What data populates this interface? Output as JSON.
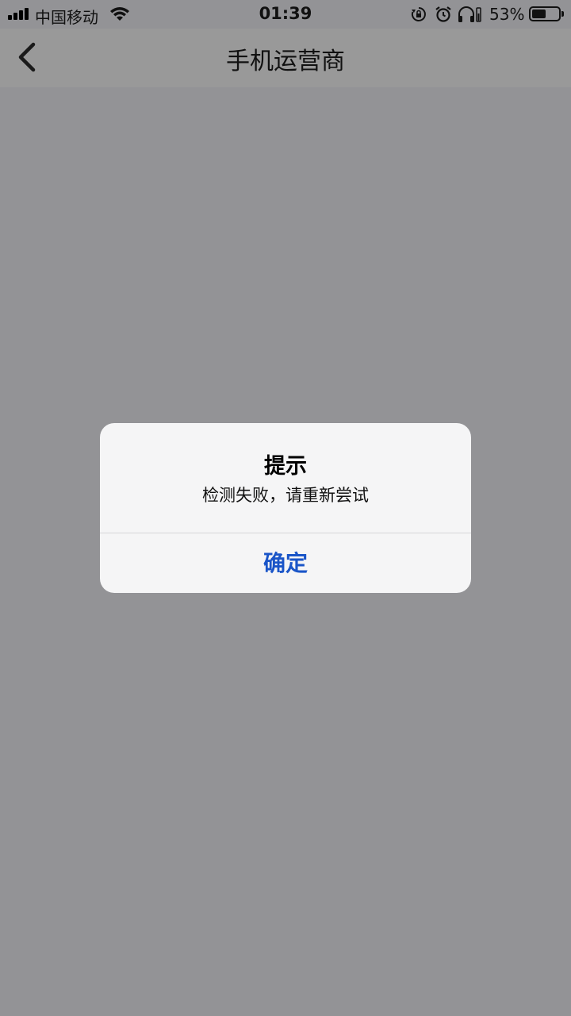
{
  "status_bar": {
    "carrier": "中国移动",
    "time": "01:39",
    "battery_percent": "53%",
    "battery_level": 0.53,
    "icons": [
      "signal-icon",
      "wifi-icon",
      "rotation-lock-icon",
      "alarm-icon",
      "headphones-icon",
      "battery-icon"
    ]
  },
  "nav": {
    "title": "手机运营商",
    "back_icon": "chevron-left-icon"
  },
  "alert": {
    "title": "提示",
    "message": "检测失败，请重新尝试",
    "confirm_label": "确定"
  },
  "colors": {
    "overlay_background": "#939396",
    "alert_background": "#f5f5f6",
    "button_blue": "#1a55c8"
  }
}
